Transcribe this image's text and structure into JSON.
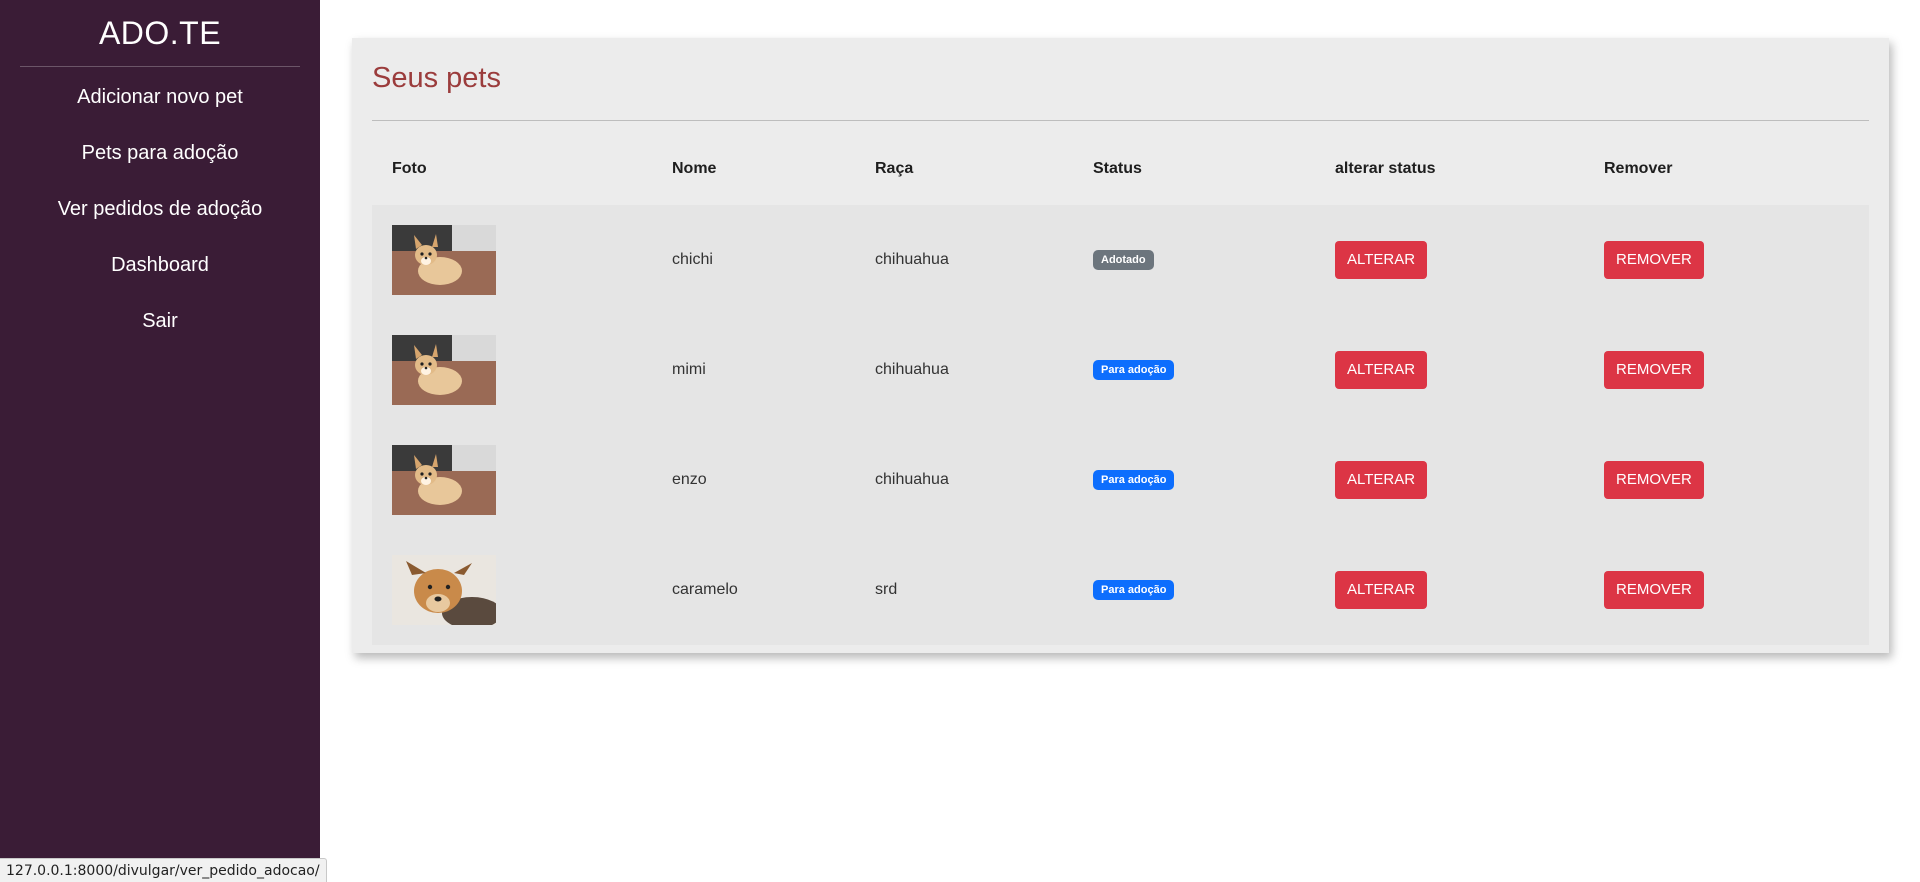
{
  "sidebar": {
    "brand": "ADO.TE",
    "items": [
      {
        "label": "Adicionar novo pet"
      },
      {
        "label": "Pets para adoção"
      },
      {
        "label": "Ver pedidos de adoção"
      },
      {
        "label": "Dashboard"
      },
      {
        "label": "Sair"
      }
    ]
  },
  "main": {
    "title": "Seus pets",
    "columns": [
      "Foto",
      "Nome",
      "Raça",
      "Status",
      "alterar status",
      "Remover"
    ],
    "rows": [
      {
        "photo_icon": "chihuahua-photo",
        "nome": "chichi",
        "raca": "chihuahua",
        "status": "Adotado",
        "status_color": "#6c757d",
        "alterar": "ALTERAR",
        "remover": "REMOVER"
      },
      {
        "photo_icon": "chihuahua-photo",
        "nome": "mimi",
        "raca": "chihuahua",
        "status": "Para adoção",
        "status_color": "#0d6efd",
        "alterar": "ALTERAR",
        "remover": "REMOVER"
      },
      {
        "photo_icon": "chihuahua-photo",
        "nome": "enzo",
        "raca": "chihuahua",
        "status": "Para adoção",
        "status_color": "#0d6efd",
        "alterar": "ALTERAR",
        "remover": "REMOVER"
      },
      {
        "photo_icon": "mixed-dog-photo",
        "nome": "caramelo",
        "raca": "srd",
        "status": "Para adoção",
        "status_color": "#0d6efd",
        "alterar": "ALTERAR",
        "remover": "REMOVER"
      }
    ]
  },
  "statusbar": {
    "url": "127.0.0.1:8000/divulgar/ver_pedido_adocao/"
  },
  "colors": {
    "sidebar_bg": "#3a1c36",
    "title": "#9b3c3c",
    "danger": "#dc3545",
    "badge_adotado": "#6c757d",
    "badge_para_adocao": "#0d6efd"
  }
}
